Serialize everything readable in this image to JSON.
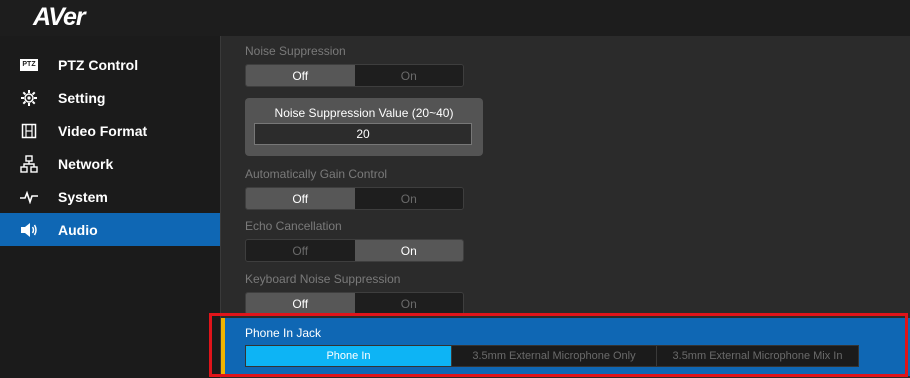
{
  "app": {
    "logo": "AVer"
  },
  "sidebar": {
    "items": [
      {
        "label": "PTZ Control",
        "icon": "ptz-icon",
        "badge": "PTZ",
        "active": false
      },
      {
        "label": "Setting",
        "icon": "gear-icon",
        "active": false
      },
      {
        "label": "Video Format",
        "icon": "film-icon",
        "active": false
      },
      {
        "label": "Network",
        "icon": "network-icon",
        "active": false
      },
      {
        "label": "System",
        "icon": "pulse-icon",
        "active": false
      },
      {
        "label": "Audio",
        "icon": "speaker-icon",
        "active": true
      }
    ]
  },
  "audio": {
    "noise_suppression": {
      "label": "Noise Suppression",
      "options": [
        "Off",
        "On"
      ],
      "selected": "Off"
    },
    "noise_value": {
      "title": "Noise Suppression Value (20~40)",
      "value": "20"
    },
    "agc": {
      "label": "Automatically Gain Control",
      "options": [
        "Off",
        "On"
      ],
      "selected": "Off"
    },
    "echo": {
      "label": "Echo Cancellation",
      "options": [
        "Off",
        "On"
      ],
      "selected": "On"
    },
    "keyboard": {
      "label": "Keyboard Noise Suppression",
      "options": [
        "Off",
        "On"
      ],
      "selected": "Off"
    },
    "phone_jack": {
      "label": "Phone In Jack",
      "options": [
        "Phone In",
        "3.5mm External Microphone Only",
        "3.5mm External Microphone Mix In"
      ],
      "selected": "Phone In"
    }
  },
  "colors": {
    "accent_blue": "#0f67b4",
    "selected_cyan": "#0db4f5",
    "highlight_red": "#e0141a",
    "accent_yellow": "#f0b400"
  }
}
